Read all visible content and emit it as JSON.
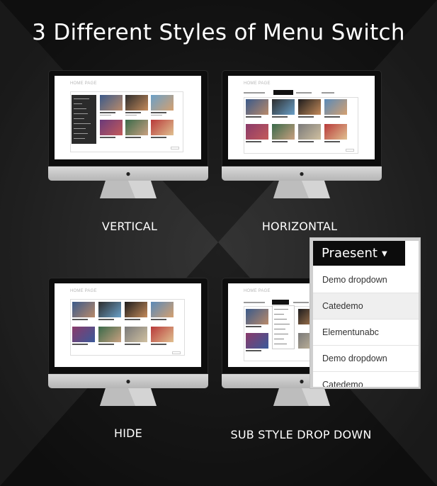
{
  "headline": "3 Different Styles of Menu Switch",
  "panels": [
    {
      "id": "vertical",
      "label": "VERTICAL",
      "screen_title": "HOME PAGE"
    },
    {
      "id": "horizontal",
      "label": "HORIZONTAL",
      "screen_title": "HOME PAGE"
    },
    {
      "id": "hide",
      "label": "HIDE",
      "screen_title": "HOME PAGE"
    },
    {
      "id": "sub",
      "label": "SUB STYLE DROP DOWN",
      "screen_title": "HOME PAGE"
    }
  ],
  "dropdown": {
    "trigger_label": "Praesent",
    "trigger_icon": "caret-down-icon",
    "items": [
      "Demo dropdown",
      "Catedemo",
      "Elementunabc",
      "Demo dropdown",
      "Catedemo"
    ]
  },
  "icons": {
    "monitor_logo": "apple-logo-icon"
  },
  "colors": {
    "background": "#141414",
    "trigger_bg": "#0c0c0c",
    "menu_highlight": "#efefef",
    "chin": "#c9c9c9"
  }
}
